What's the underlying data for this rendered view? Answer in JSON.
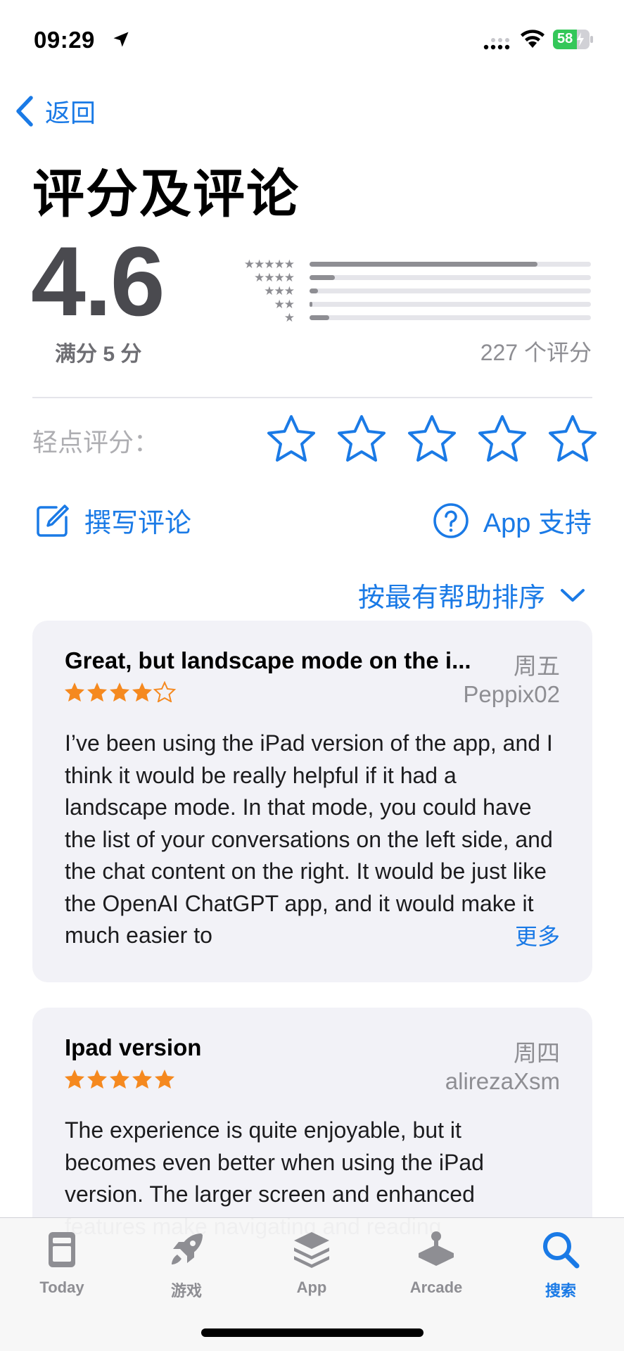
{
  "status_bar": {
    "time": "09:29",
    "battery": "58"
  },
  "nav": {
    "back_label": "返回"
  },
  "header": {
    "title": "评分及评论"
  },
  "summary": {
    "score": "4.6",
    "out_of": "满分 5 分",
    "count": "227 个评分",
    "histogram": [
      {
        "stars": "★★★★★",
        "fraction": 0.81
      },
      {
        "stars": "★★★★",
        "fraction": 0.09
      },
      {
        "stars": "★★★",
        "fraction": 0.03
      },
      {
        "stars": "★★",
        "fraction": 0.01
      },
      {
        "stars": "★",
        "fraction": 0.07
      }
    ]
  },
  "tap_to_rate": {
    "label": "轻点评分："
  },
  "actions": {
    "write_review": "撰写评论",
    "app_support": "App 支持"
  },
  "sort": {
    "label": "按最有帮助排序"
  },
  "reviews": [
    {
      "title": "Great, but landscape mode on the i...",
      "date": "周五",
      "author": "Peppix02",
      "rating": 4,
      "body": "I’ve been using the iPad version of the app, and I think it would be really helpful if it had a landscape mode. In that mode, you could have the list of your conversations on the left side, and the chat content on the right. It would be just like the OpenAI ChatGPT app, and it would make it much easier to",
      "more": "更多"
    },
    {
      "title": "Ipad version",
      "date": "周四",
      "author": "alirezaXsm",
      "rating": 5,
      "body": "The experience is quite enjoyable, but it becomes even better when using the iPad version. The larger screen and enhanced features make navigating and reading"
    }
  ],
  "tab_bar": {
    "tabs": [
      {
        "label": "Today",
        "icon": "today-icon",
        "active": false
      },
      {
        "label": "游戏",
        "icon": "rocket-icon",
        "active": false
      },
      {
        "label": "App",
        "icon": "app-stack-icon",
        "active": false
      },
      {
        "label": "Arcade",
        "icon": "joystick-icon",
        "active": false
      },
      {
        "label": "搜索",
        "icon": "search-icon",
        "active": true
      }
    ]
  },
  "colors": {
    "accent": "#1a7ae6",
    "star_orange": "#f5891f",
    "card_bg": "#f2f2f7"
  }
}
